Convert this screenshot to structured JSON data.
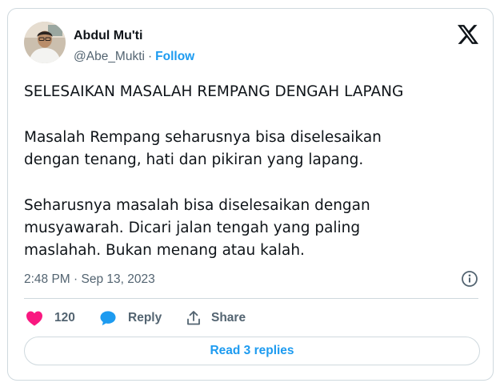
{
  "author": {
    "name": "Abdul Mu'ti",
    "handle": "@Abe_Mukti",
    "separator": "·",
    "follow_label": "Follow"
  },
  "tweet": {
    "paragraphs": [
      [
        "SELESAIKAN MASALAH REMPANG DENGAH LAPANG"
      ],
      [
        "Masalah Rempang seharusnya bisa diselesaikan",
        "dengan tenang, hati dan pikiran yang lapang."
      ],
      [
        "Seharusnya masalah bisa diselesaikan dengan",
        "musyawarah. Dicari jalan tengah yang paling",
        "maslahah. Bukan menang atau kalah."
      ]
    ],
    "timestamp": "2:48 PM · Sep 13, 2023"
  },
  "actions": {
    "like_count": "120",
    "reply_label": "Reply",
    "share_label": "Share"
  },
  "read_replies_label": "Read 3 replies",
  "icons": {
    "brand": "x-logo-icon",
    "like": "heart-icon",
    "reply": "speech-bubble-icon",
    "share": "share-upload-icon",
    "info": "info-icon"
  },
  "colors": {
    "accent": "#1d9bf0",
    "like": "#f91880",
    "text": "#0f1419",
    "muted": "#536471",
    "border": "#cfd9de"
  }
}
